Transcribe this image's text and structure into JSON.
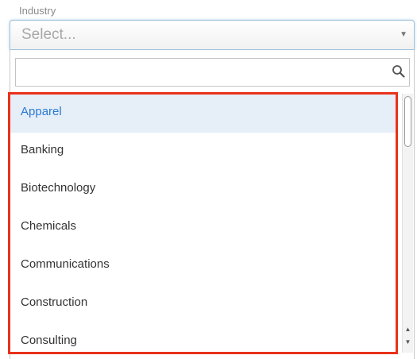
{
  "field": {
    "label": "Industry",
    "placeholder": "Select...",
    "arrow": "▼"
  },
  "search": {
    "value": "",
    "icon": "magnifier-icon"
  },
  "options": [
    {
      "label": "Apparel",
      "selected": true
    },
    {
      "label": "Banking",
      "selected": false
    },
    {
      "label": "Biotechnology",
      "selected": false
    },
    {
      "label": "Chemicals",
      "selected": false
    },
    {
      "label": "Communications",
      "selected": false
    },
    {
      "label": "Construction",
      "selected": false
    },
    {
      "label": "Consulting",
      "selected": false
    }
  ],
  "scrollbar": {
    "up_arrow": "▲",
    "down_arrow": "▼"
  },
  "colors": {
    "selected_text": "#2a7ad2",
    "selected_bg": "#e6eef7",
    "highlight_border": "#e8321b",
    "focus_border": "#9fc3dc"
  }
}
